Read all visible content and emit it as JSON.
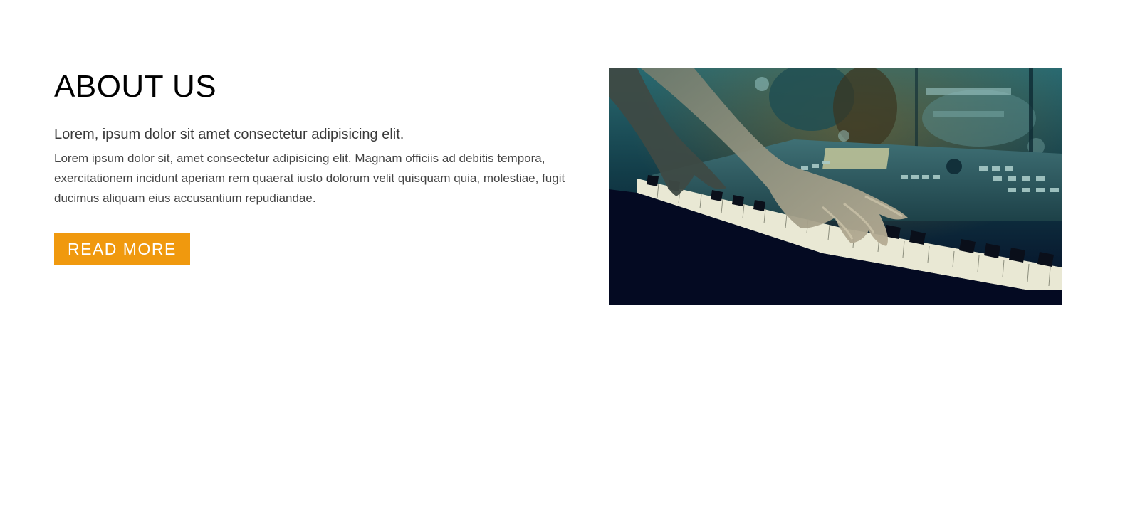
{
  "about": {
    "title": "ABOUT US",
    "subtitle": "Lorem, ipsum dolor sit amet consectetur adipisicing elit.",
    "body": "Lorem ipsum dolor sit, amet consectetur adipisicing elit. Magnam officiis ad debitis tempora, exercitationem incidunt aperiam rem quaerat iusto dolorum velit quisquam quia, molestiae, fugit ducimus aliquam eius accusantium repudiandae.",
    "button_label": "READ MORE"
  },
  "image": {
    "subject": "hands-playing-keyboard-photo"
  },
  "colors": {
    "accent": "#f0990e",
    "title": "#000000",
    "text": "#444444",
    "image_tint_dark": "#07142a",
    "image_tint_teal": "#2f6f73"
  }
}
